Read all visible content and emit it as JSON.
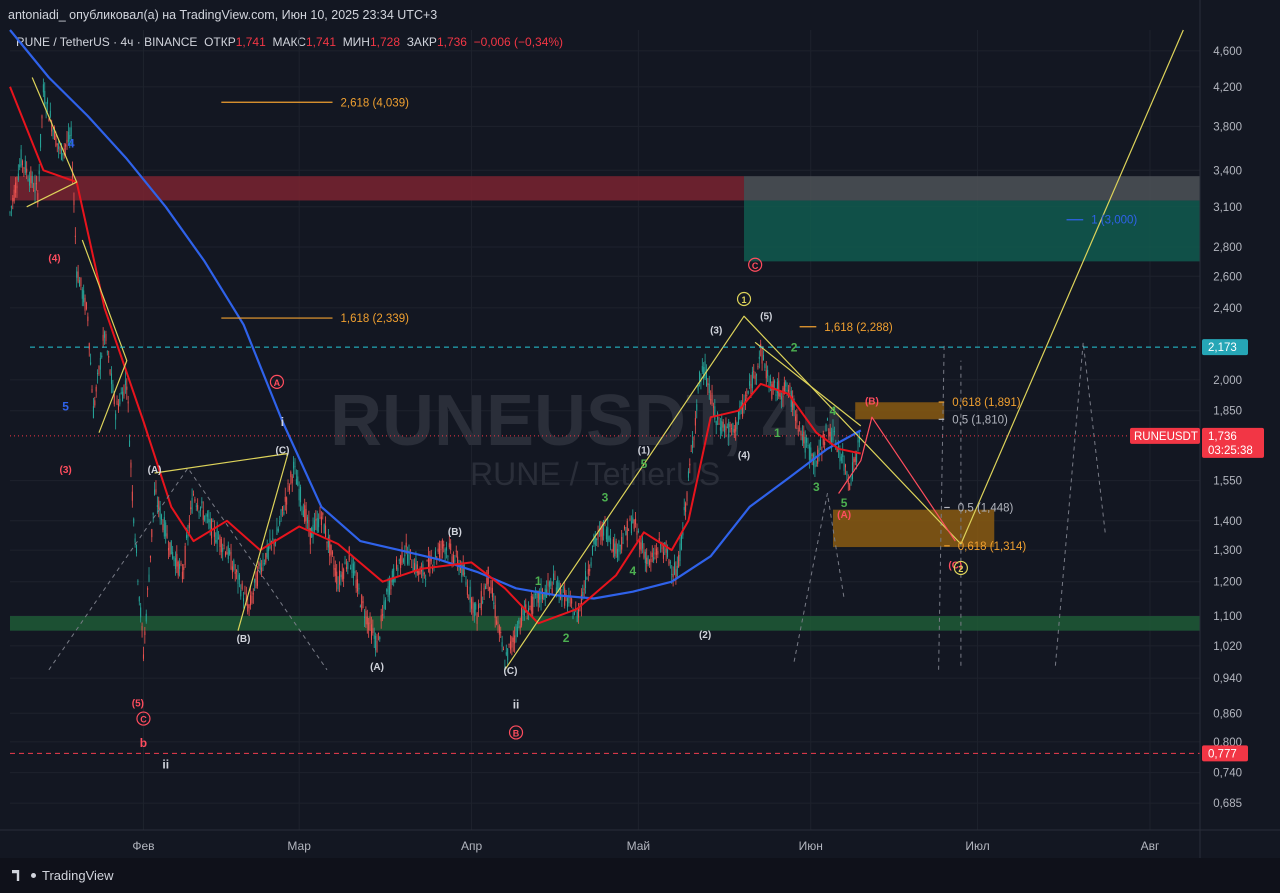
{
  "header": {
    "published": "antoniadi_ опубликовал(а) на TradingView.com, Июн 10, 2025 23:34 UTC+3"
  },
  "symbol_line": {
    "name": "RUNE / TetherUS · 4ч · BINANCE",
    "open_label": "ОТКР",
    "open": "1,741",
    "high_label": "МАКС",
    "high": "1,741",
    "low_label": "МИН",
    "low": "1,728",
    "close_label": "ЗАКР",
    "close": "1,736",
    "change": "−0,006 (−0,34%)"
  },
  "watermark": {
    "ticker": "RUNEUSDT",
    "interval": "4ч",
    "name": "RUNE / TetherUS"
  },
  "price_tags": {
    "current_name": "RUNEUSDT",
    "current_price": "1,736",
    "countdown": "03:25:38",
    "cyan_level": "2,173",
    "red_level": "0,777"
  },
  "footer": {
    "brand": "TradingView"
  },
  "colors": {
    "background": "#131722",
    "bullish": "#26a69a",
    "bearish": "#ef5350",
    "ma_red": "#e8141d",
    "ma_blue": "#2f62ea",
    "wave_yellow": "#ddd35a",
    "fib_orange": "#f0a030",
    "cyan_dash": "#25c8d7",
    "red_dash": "#ef3c4d"
  },
  "chart_data": {
    "type": "candlestick",
    "scale": "log",
    "ylim": [
      0.64,
      4.85
    ],
    "x_range": [
      "2025-01-08",
      "2025-08-10"
    ],
    "x_ticks": [
      {
        "date": "2025-02-01",
        "label": "Фев"
      },
      {
        "date": "2025-03-01",
        "label": "Мар"
      },
      {
        "date": "2025-04-01",
        "label": "Апр"
      },
      {
        "date": "2025-05-01",
        "label": "Май"
      },
      {
        "date": "2025-06-01",
        "label": "Июн"
      },
      {
        "date": "2025-07-01",
        "label": "Июл"
      },
      {
        "date": "2025-08-01",
        "label": "Авг"
      }
    ],
    "y_ticks": [
      "4,600",
      "4,200",
      "3,800",
      "3,400",
      "3,100",
      "2,800",
      "2,600",
      "2,400",
      "2,000",
      "1,850",
      "1,550",
      "1,400",
      "1,300",
      "1,200",
      "1,100",
      "1,020",
      "0,940",
      "0,860",
      "0,800",
      "0,740",
      "0,685"
    ],
    "price_path": [
      [
        "2025-01-08",
        3.05
      ],
      [
        "2025-01-10",
        3.5
      ],
      [
        "2025-01-13",
        3.2
      ],
      [
        "2025-01-14",
        4.15
      ],
      [
        "2025-01-17",
        3.55
      ],
      [
        "2025-01-19",
        3.7
      ],
      [
        "2025-01-20",
        2.65
      ],
      [
        "2025-01-22",
        2.35
      ],
      [
        "2025-01-23",
        1.85
      ],
      [
        "2025-01-25",
        2.25
      ],
      [
        "2025-01-27",
        1.85
      ],
      [
        "2025-01-29",
        2.0
      ],
      [
        "2025-01-30",
        1.5
      ],
      [
        "2025-02-01",
        1.0
      ],
      [
        "2025-02-03",
        1.5
      ],
      [
        "2025-02-06",
        1.3
      ],
      [
        "2025-02-08",
        1.22
      ],
      [
        "2025-02-10",
        1.5
      ],
      [
        "2025-02-13",
        1.38
      ],
      [
        "2025-02-16",
        1.3
      ],
      [
        "2025-02-20",
        1.12
      ],
      [
        "2025-02-22",
        1.25
      ],
      [
        "2025-02-25",
        1.35
      ],
      [
        "2025-02-28",
        1.6
      ],
      [
        "2025-03-03",
        1.35
      ],
      [
        "2025-03-05",
        1.42
      ],
      [
        "2025-03-08",
        1.2
      ],
      [
        "2025-03-10",
        1.28
      ],
      [
        "2025-03-12",
        1.15
      ],
      [
        "2025-03-15",
        1.02
      ],
      [
        "2025-03-17",
        1.18
      ],
      [
        "2025-03-20",
        1.3
      ],
      [
        "2025-03-23",
        1.22
      ],
      [
        "2025-03-27",
        1.32
      ],
      [
        "2025-03-30",
        1.25
      ],
      [
        "2025-04-02",
        1.1
      ],
      [
        "2025-04-04",
        1.22
      ],
      [
        "2025-04-07",
        0.98
      ],
      [
        "2025-04-10",
        1.1
      ],
      [
        "2025-04-13",
        1.15
      ],
      [
        "2025-04-16",
        1.2
      ],
      [
        "2025-04-20",
        1.1
      ],
      [
        "2025-04-23",
        1.32
      ],
      [
        "2025-04-25",
        1.38
      ],
      [
        "2025-04-27",
        1.3
      ],
      [
        "2025-04-30",
        1.4
      ],
      [
        "2025-05-03",
        1.25
      ],
      [
        "2025-05-05",
        1.32
      ],
      [
        "2025-05-08",
        1.22
      ],
      [
        "2025-05-10",
        1.55
      ],
      [
        "2025-05-12",
        2.0
      ],
      [
        "2025-05-13",
        2.05
      ],
      [
        "2025-05-15",
        1.8
      ],
      [
        "2025-05-18",
        1.75
      ],
      [
        "2025-05-21",
        1.95
      ],
      [
        "2025-05-23",
        2.15
      ],
      [
        "2025-05-25",
        1.95
      ],
      [
        "2025-05-28",
        1.95
      ],
      [
        "2025-05-31",
        1.7
      ],
      [
        "2025-06-02",
        1.62
      ],
      [
        "2025-06-04",
        1.78
      ],
      [
        "2025-06-06",
        1.68
      ],
      [
        "2025-06-08",
        1.55
      ],
      [
        "2025-06-10",
        1.736
      ]
    ],
    "ma_red": [
      [
        "2025-01-08",
        4.2
      ],
      [
        "2025-01-14",
        3.4
      ],
      [
        "2025-01-20",
        3.3
      ],
      [
        "2025-01-25",
        2.4
      ],
      [
        "2025-02-01",
        1.8
      ],
      [
        "2025-02-06",
        1.45
      ],
      [
        "2025-02-10",
        1.33
      ],
      [
        "2025-02-16",
        1.4
      ],
      [
        "2025-02-22",
        1.3
      ],
      [
        "2025-03-01",
        1.38
      ],
      [
        "2025-03-08",
        1.32
      ],
      [
        "2025-03-16",
        1.2
      ],
      [
        "2025-03-23",
        1.24
      ],
      [
        "2025-04-01",
        1.26
      ],
      [
        "2025-04-07",
        1.18
      ],
      [
        "2025-04-13",
        1.08
      ],
      [
        "2025-04-20",
        1.12
      ],
      [
        "2025-04-27",
        1.22
      ],
      [
        "2025-05-02",
        1.36
      ],
      [
        "2025-05-07",
        1.3
      ],
      [
        "2025-05-10",
        1.4
      ],
      [
        "2025-05-14",
        1.82
      ],
      [
        "2025-05-19",
        1.85
      ],
      [
        "2025-05-23",
        1.98
      ],
      [
        "2025-05-28",
        1.93
      ],
      [
        "2025-06-02",
        1.75
      ],
      [
        "2025-06-06",
        1.68
      ],
      [
        "2025-06-10",
        1.66
      ]
    ],
    "ma_blue": [
      [
        "2025-01-08",
        4.85
      ],
      [
        "2025-01-15",
        4.3
      ],
      [
        "2025-01-22",
        3.9
      ],
      [
        "2025-01-29",
        3.5
      ],
      [
        "2025-02-05",
        3.1
      ],
      [
        "2025-02-12",
        2.7
      ],
      [
        "2025-02-19",
        2.3
      ],
      [
        "2025-02-26",
        1.8
      ],
      [
        "2025-03-05",
        1.45
      ],
      [
        "2025-03-12",
        1.33
      ],
      [
        "2025-03-19",
        1.3
      ],
      [
        "2025-03-26",
        1.27
      ],
      [
        "2025-04-02",
        1.23
      ],
      [
        "2025-04-09",
        1.18
      ],
      [
        "2025-04-16",
        1.16
      ],
      [
        "2025-04-23",
        1.15
      ],
      [
        "2025-04-30",
        1.17
      ],
      [
        "2025-05-07",
        1.2
      ],
      [
        "2025-05-14",
        1.28
      ],
      [
        "2025-05-21",
        1.45
      ],
      [
        "2025-05-28",
        1.56
      ],
      [
        "2025-06-04",
        1.68
      ],
      [
        "2025-06-10",
        1.76
      ]
    ],
    "zones": [
      {
        "from": "2025-01-08",
        "to": "2025-05-20",
        "y0": 3.15,
        "y1": 3.35,
        "color": "#7a2330"
      },
      {
        "from": "2025-05-20",
        "to": "2025-08-10",
        "y0": 3.15,
        "y1": 3.35,
        "color": "#4e5257"
      },
      {
        "from": "2025-05-20",
        "to": "2025-08-10",
        "y0": 2.7,
        "y1": 3.15,
        "color": "#105a4f"
      },
      {
        "from": "2025-01-08",
        "to": "2025-08-10",
        "y0": 1.06,
        "y1": 1.1,
        "color": "#1f5a36"
      },
      {
        "from": "2025-06-09",
        "to": "2025-06-25",
        "y0": 1.81,
        "y1": 1.89,
        "color": "#8a5a12"
      },
      {
        "from": "2025-06-05",
        "to": "2025-07-04",
        "y0": 1.31,
        "y1": 1.44,
        "color": "#8a5a12"
      }
    ],
    "levels": [
      {
        "price": 2.173,
        "style": "cyan-dash"
      },
      {
        "price": 0.777,
        "style": "red-dash"
      },
      {
        "price": 1.736,
        "style": "red-dot"
      }
    ],
    "fib_lines": [
      {
        "label": "2,618 (4,039)",
        "price": 4.039,
        "from": "2025-02-15",
        "to": "2025-03-07",
        "color": "#f0a030"
      },
      {
        "label": "1,618 (2,339)",
        "price": 2.339,
        "from": "2025-02-15",
        "to": "2025-03-07",
        "color": "#f0a030"
      },
      {
        "label": "1,618 (2,288)",
        "price": 2.288,
        "from": "2025-05-30",
        "to": "2025-06-02",
        "color": "#f0a030"
      },
      {
        "label": "0,618 (1,891)",
        "price": 1.891,
        "from": "2025-06-24",
        "to": "2025-06-25",
        "color": "#f0a030"
      },
      {
        "label": "0,5 (1,810)",
        "price": 1.81,
        "from": "2025-06-24",
        "to": "2025-06-25",
        "color": "#b2b5be"
      },
      {
        "label": "0,5 (1,448)",
        "price": 1.448,
        "from": "2025-06-25",
        "to": "2025-06-26",
        "color": "#b2b5be"
      },
      {
        "label": "0,618 (1,314)",
        "price": 1.314,
        "from": "2025-06-25",
        "to": "2025-06-26",
        "color": "#f0a030"
      },
      {
        "label": "1 (3,000)",
        "price": 3.0,
        "from": "2025-07-17",
        "to": "2025-07-20",
        "color": "#2f62ea"
      }
    ],
    "wave_lines": [
      {
        "color": "#ddd35a",
        "points": [
          [
            "2025-01-12",
            4.3
          ],
          [
            "2025-01-20",
            3.3
          ],
          [
            "2025-01-11",
            3.1
          ]
        ]
      },
      {
        "color": "#ddd35a",
        "points": [
          [
            "2025-01-21",
            2.85
          ],
          [
            "2025-01-29",
            2.1
          ],
          [
            "2025-01-24",
            1.75
          ]
        ]
      },
      {
        "color": "#ddd35a",
        "points": [
          [
            "2025-02-03",
            1.58
          ],
          [
            "2025-02-27",
            1.66
          ],
          [
            "2025-02-18",
            1.06
          ]
        ]
      },
      {
        "color": "#ddd35a",
        "points": [
          [
            "2025-04-07",
            0.96
          ],
          [
            "2025-05-20",
            2.35
          ],
          [
            "2025-06-28",
            1.32
          ]
        ]
      },
      {
        "color": "#ddd35a",
        "points": [
          [
            "2025-06-28",
            1.32
          ],
          [
            "2025-08-07",
            4.85
          ]
        ]
      },
      {
        "color": "#ddd35a",
        "points": [
          [
            "2025-05-22",
            2.2
          ],
          [
            "2025-06-10",
            1.78
          ]
        ]
      },
      {
        "color": "#ff4d5e",
        "points": [
          [
            "2025-06-06",
            1.5
          ],
          [
            "2025-06-10",
            1.63
          ],
          [
            "2025-06-12",
            1.82
          ],
          [
            "2025-06-27",
            1.33
          ]
        ]
      }
    ],
    "projection_dashes": [
      [
        [
          "2025-06-24",
          0.96
        ],
        [
          "2025-06-25",
          2.2
        ]
      ],
      [
        [
          "2025-06-28",
          0.97
        ],
        [
          "2025-06-28",
          2.1
        ]
      ],
      [
        [
          "2025-07-15",
          0.97
        ],
        [
          "2025-07-20",
          2.2
        ],
        [
          "2025-07-24",
          1.35
        ]
      ],
      [
        [
          "2025-05-29",
          0.98
        ],
        [
          "2025-06-04",
          1.5
        ],
        [
          "2025-06-07",
          1.15
        ]
      ],
      [
        [
          "2025-01-15",
          0.96
        ],
        [
          "2025-02-09",
          1.6
        ],
        [
          "2025-03-06",
          0.96
        ]
      ]
    ],
    "wave_labels": [
      {
        "text": "(4)",
        "date": "2025-01-16",
        "price": 2.7,
        "color": "#ff4d5e"
      },
      {
        "text": "4",
        "date": "2025-01-19",
        "price": 3.6,
        "color": "#2f62ea"
      },
      {
        "text": "5",
        "date": "2025-01-18",
        "price": 1.85,
        "color": "#2f62ea"
      },
      {
        "text": "(3)",
        "date": "2025-01-18",
        "price": 1.58,
        "color": "#ff4d5e"
      },
      {
        "text": "(5)",
        "date": "2025-01-31",
        "price": 0.875,
        "color": "#ff4d5e"
      },
      {
        "text": "C",
        "date": "2025-02-01",
        "price": 0.84,
        "color": "#ff4d5e",
        "circled": true
      },
      {
        "text": "b",
        "date": "2025-02-01",
        "price": 0.79,
        "color": "#ff4d5e"
      },
      {
        "text": "ii",
        "date": "2025-02-05",
        "price": 0.748,
        "color": "#d1d4dc"
      },
      {
        "text": "(A)",
        "date": "2025-02-03",
        "price": 1.58,
        "color": "#d1d4dc"
      },
      {
        "text": "(B)",
        "date": "2025-02-19",
        "price": 1.03,
        "color": "#d1d4dc"
      },
      {
        "text": "(C)",
        "date": "2025-02-26",
        "price": 1.66,
        "color": "#d1d4dc"
      },
      {
        "text": "A",
        "date": "2025-02-25",
        "price": 1.97,
        "color": "#ff4d5e",
        "circled": true
      },
      {
        "text": "i",
        "date": "2025-02-26",
        "price": 1.78,
        "color": "#d1d4dc"
      },
      {
        "text": "(A)",
        "date": "2025-03-15",
        "price": 0.96,
        "color": "#d1d4dc"
      },
      {
        "text": "(B)",
        "date": "2025-03-29",
        "price": 1.35,
        "color": "#d1d4dc"
      },
      {
        "text": "(C)",
        "date": "2025-04-08",
        "price": 0.95,
        "color": "#d1d4dc"
      },
      {
        "text": "ii",
        "date": "2025-04-09",
        "price": 0.87,
        "color": "#d1d4dc"
      },
      {
        "text": "B",
        "date": "2025-04-09",
        "price": 0.811,
        "color": "#ff4d5e",
        "circled": true
      },
      {
        "text": "1",
        "date": "2025-04-13",
        "price": 1.19,
        "color": "#4caf50"
      },
      {
        "text": "2",
        "date": "2025-04-18",
        "price": 1.03,
        "color": "#4caf50"
      },
      {
        "text": "3",
        "date": "2025-04-25",
        "price": 1.47,
        "color": "#4caf50"
      },
      {
        "text": "4",
        "date": "2025-04-30",
        "price": 1.22,
        "color": "#4caf50"
      },
      {
        "text": "5",
        "date": "2025-05-02",
        "price": 1.6,
        "color": "#4caf50"
      },
      {
        "text": "(1)",
        "date": "2025-05-02",
        "price": 1.66,
        "color": "#d1d4dc"
      },
      {
        "text": "(2)",
        "date": "2025-05-13",
        "price": 1.04,
        "color": "#d1d4dc"
      },
      {
        "text": "(3)",
        "date": "2025-05-15",
        "price": 2.25,
        "color": "#d1d4dc"
      },
      {
        "text": "(4)",
        "date": "2025-05-20",
        "price": 1.64,
        "color": "#d1d4dc"
      },
      {
        "text": "(5)",
        "date": "2025-05-24",
        "price": 2.33,
        "color": "#d1d4dc"
      },
      {
        "text": "1",
        "date": "2025-05-20",
        "price": 2.43,
        "color": "#ddd35a",
        "circled": true
      },
      {
        "text": "C",
        "date": "2025-05-22",
        "price": 2.65,
        "color": "#ff4d5e",
        "circled": true
      },
      {
        "text": "1",
        "date": "2025-05-26",
        "price": 1.73,
        "color": "#4caf50"
      },
      {
        "text": "2",
        "date": "2025-05-29",
        "price": 2.15,
        "color": "#4caf50"
      },
      {
        "text": "3",
        "date": "2025-06-02",
        "price": 1.51,
        "color": "#4caf50"
      },
      {
        "text": "4",
        "date": "2025-06-05",
        "price": 1.83,
        "color": "#4caf50"
      },
      {
        "text": "5",
        "date": "2025-06-07",
        "price": 1.45,
        "color": "#4caf50"
      },
      {
        "text": "(A)",
        "date": "2025-06-07",
        "price": 1.41,
        "color": "#ff4d5e"
      },
      {
        "text": "(B)",
        "date": "2025-06-12",
        "price": 1.88,
        "color": "#ff4d5e"
      },
      {
        "text": "(C)",
        "date": "2025-06-27",
        "price": 1.24,
        "color": "#ff4d5e"
      },
      {
        "text": "2",
        "date": "2025-06-28",
        "price": 1.23,
        "color": "#ddd35a",
        "circled": true
      }
    ]
  }
}
